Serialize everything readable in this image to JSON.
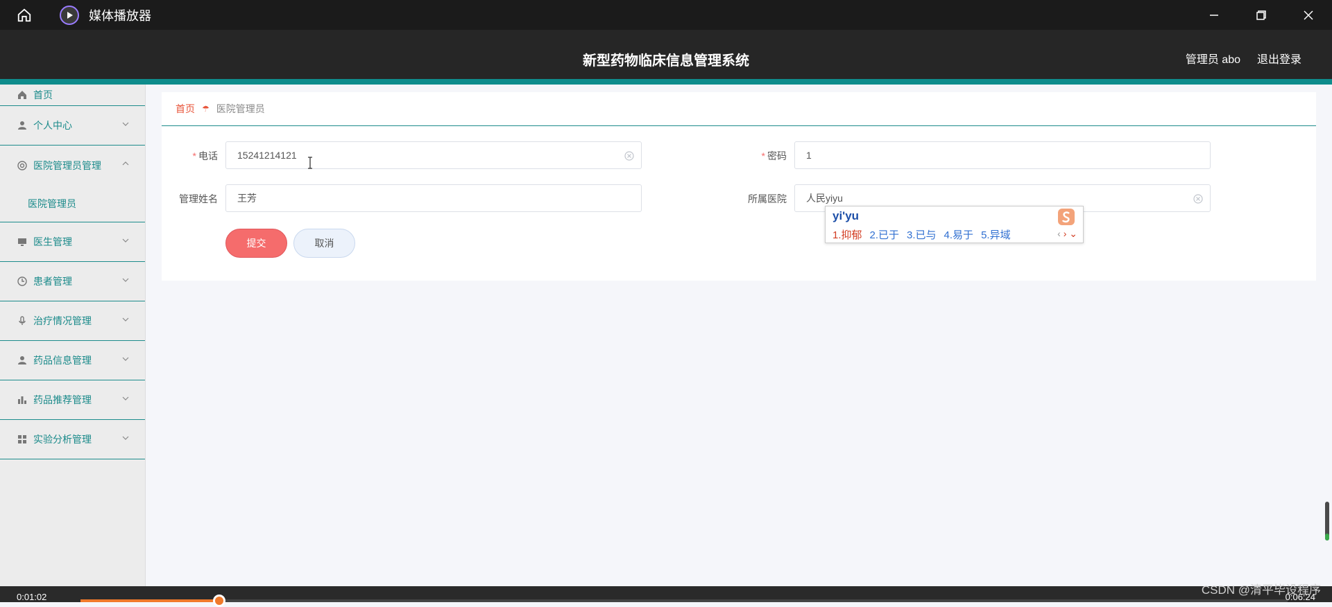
{
  "player": {
    "title": "媒体播放器",
    "time_current": "0:01:02",
    "time_total": "0:06:24",
    "progress_fraction": 0.115
  },
  "header": {
    "title": "新型药物临床信息管理系统",
    "user": "管理员 abo",
    "logout": "退出登录"
  },
  "sidebar": {
    "items": [
      {
        "label": "首页"
      },
      {
        "label": "个人中心"
      },
      {
        "label": "医院管理员管理"
      },
      {
        "label": "医院管理员"
      },
      {
        "label": "医生管理"
      },
      {
        "label": "患者管理"
      },
      {
        "label": "治疗情况管理"
      },
      {
        "label": "药品信息管理"
      },
      {
        "label": "药品推荐管理"
      },
      {
        "label": "实验分析管理"
      }
    ]
  },
  "breadcrumb": {
    "home": "首页",
    "current": "医院管理员"
  },
  "form": {
    "phone_label": "电话",
    "phone_value": "15241214121",
    "password_label": "密码",
    "password_value": "1",
    "name_label": "管理姓名",
    "name_value": "王芳",
    "hospital_label": "所属医院",
    "hospital_value": "人民yiyu",
    "required_mark": "*",
    "submit": "提交",
    "cancel": "取消"
  },
  "ime": {
    "composition": "yi'yu",
    "candidates": [
      "1.抑郁",
      "2.已于",
      "3.已与",
      "4.易于",
      "5.异域"
    ]
  },
  "watermark": "CSDN @清平毕设程序",
  "colors": {
    "teal": "#0e8c8c",
    "danger": "#f56c6c",
    "accent_orange": "#f07a2b"
  }
}
